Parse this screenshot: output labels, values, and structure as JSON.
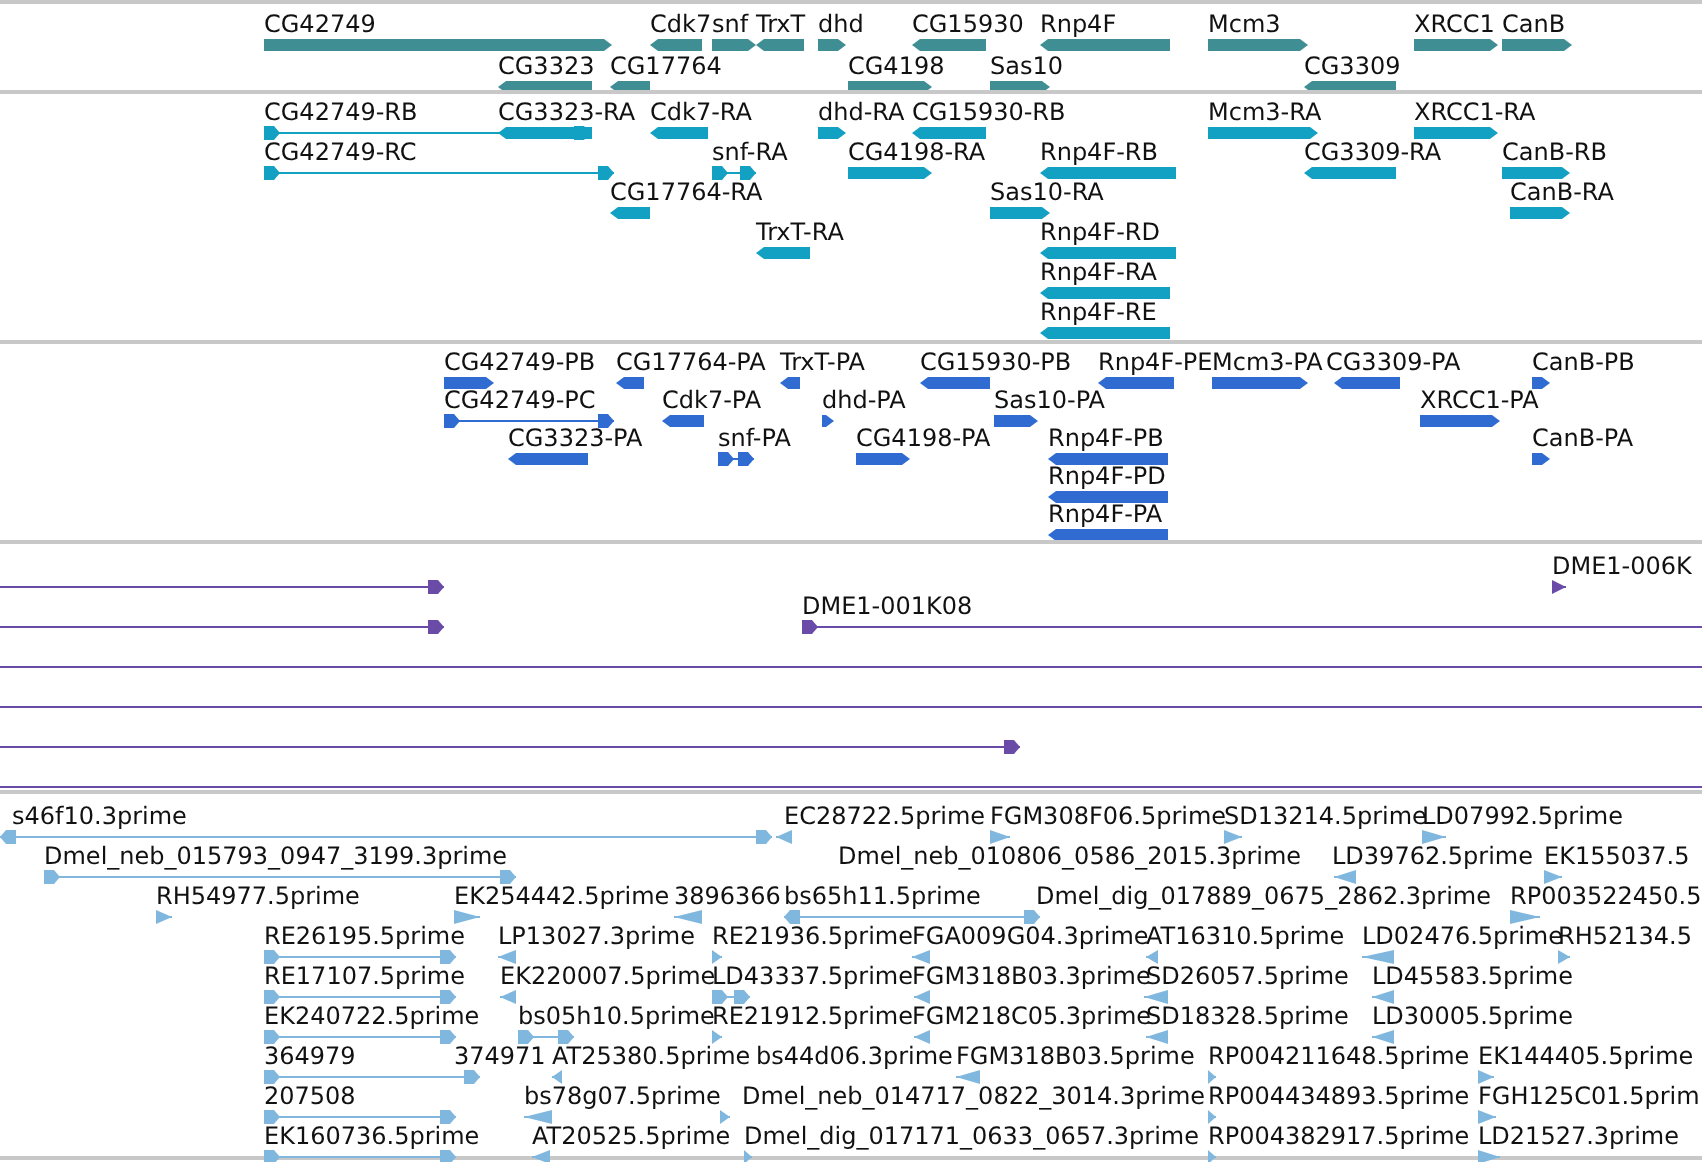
{
  "tracks": [
    {
      "kind": "gene",
      "features": [
        {
          "label": "CG42749",
          "reverse": false
        },
        {
          "label": "Cdk7",
          "reverse": true
        },
        {
          "label": "snf",
          "reverse": false
        },
        {
          "label": "TrxT",
          "reverse": true
        },
        {
          "label": "dhd",
          "reverse": false
        },
        {
          "label": "CG15930",
          "reverse": true
        },
        {
          "label": "Rnp4F",
          "reverse": true
        },
        {
          "label": "Mcm3",
          "reverse": false
        },
        {
          "label": "XRCC1",
          "reverse": false
        },
        {
          "label": "CanB",
          "reverse": false
        },
        {
          "label": "CG3323",
          "reverse": true
        },
        {
          "label": "CG17764",
          "reverse": true
        },
        {
          "label": "CG4198",
          "reverse": false
        },
        {
          "label": "Sas10",
          "reverse": false
        },
        {
          "label": "CG3309",
          "reverse": true
        }
      ]
    },
    {
      "kind": "transcript",
      "features": [
        {
          "label": "CG42749-RB",
          "reverse": false
        },
        {
          "label": "CG3323-RA",
          "reverse": true
        },
        {
          "label": "Cdk7-RA",
          "reverse": true
        },
        {
          "label": "dhd-RA",
          "reverse": false
        },
        {
          "label": "CG15930-RB",
          "reverse": true
        },
        {
          "label": "Mcm3-RA",
          "reverse": false
        },
        {
          "label": "XRCC1-RA",
          "reverse": false
        },
        {
          "label": "CG42749-RC",
          "reverse": false
        },
        {
          "label": "snf-RA",
          "reverse": false
        },
        {
          "label": "CG4198-RA",
          "reverse": false
        },
        {
          "label": "Rnp4F-RB",
          "reverse": true
        },
        {
          "label": "CG3309-RA",
          "reverse": true
        },
        {
          "label": "CanB-RB",
          "reverse": false
        },
        {
          "label": "CG17764-RA",
          "reverse": true
        },
        {
          "label": "Sas10-RA",
          "reverse": false
        },
        {
          "label": "CanB-RA",
          "reverse": false
        },
        {
          "label": "TrxT-RA",
          "reverse": true
        },
        {
          "label": "Rnp4F-RD",
          "reverse": true
        },
        {
          "label": "Rnp4F-RA",
          "reverse": true
        },
        {
          "label": "Rnp4F-RE",
          "reverse": true
        }
      ]
    },
    {
      "kind": "protein",
      "features": [
        {
          "label": "CG42749-PB",
          "reverse": false
        },
        {
          "label": "CG17764-PA",
          "reverse": true
        },
        {
          "label": "TrxT-PA",
          "reverse": true
        },
        {
          "label": "CG15930-PB",
          "reverse": true
        },
        {
          "label": "Rnp4F-PE",
          "reverse": true
        },
        {
          "label": "Mcm3-PA",
          "reverse": false
        },
        {
          "label": "CG3309-PA",
          "reverse": true
        },
        {
          "label": "CanB-PB",
          "reverse": false
        },
        {
          "label": "CG42749-PC",
          "reverse": false
        },
        {
          "label": "Cdk7-PA",
          "reverse": true
        },
        {
          "label": "dhd-PA",
          "reverse": false
        },
        {
          "label": "Sas10-PA",
          "reverse": false
        },
        {
          "label": "XRCC1-PA",
          "reverse": false
        },
        {
          "label": "CG3323-PA",
          "reverse": true
        },
        {
          "label": "snf-PA",
          "reverse": false
        },
        {
          "label": "CG4198-PA",
          "reverse": false
        },
        {
          "label": "Rnp4F-PB",
          "reverse": true
        },
        {
          "label": "CanB-PA",
          "reverse": false
        },
        {
          "label": "Rnp4F-PD",
          "reverse": true
        },
        {
          "label": "Rnp4F-PA",
          "reverse": true
        }
      ]
    },
    {
      "kind": "clone",
      "features": [
        {
          "capped": true
        },
        {
          "label": "DME1-006K",
          "capped": true
        },
        {
          "capped": true
        },
        {
          "label": "DME1-001K08",
          "capped": true
        },
        {
          "capped": false
        },
        {
          "capped": false
        },
        {
          "capped": true
        },
        {
          "capped": false
        }
      ]
    },
    {
      "kind": "est",
      "features": [
        {
          "label": "s46f10.3prime",
          "reverse": true
        },
        {
          "label": "EC28722.5prime",
          "reverse": true
        },
        {
          "label": "FGM308F06.5prime",
          "reverse": false
        },
        {
          "label": "SD13214.5prime",
          "reverse": false
        },
        {
          "label": "LD07992.5prime",
          "reverse": false
        },
        {
          "label": "Dmel_neb_015793_0947_3199.3prime",
          "reverse": false
        },
        {
          "label": "Dmel_neb_010806_0586_2015.3prime"
        },
        {
          "label": "LD39762.5prime",
          "reverse": true
        },
        {
          "label": "EK155037.5",
          "reverse": false
        },
        {
          "label": "RH54977.5prime",
          "reverse": false
        },
        {
          "label": "EK254442.5prime",
          "reverse": false
        },
        {
          "label": "3896366",
          "reverse": true
        },
        {
          "label": "bs65h11.5prime",
          "reverse": true
        },
        {
          "label": "Dmel_dig_017889_0675_2862.3prime"
        },
        {
          "label": "RP003522450.5",
          "reverse": false
        },
        {
          "label": "RE26195.5prime",
          "reverse": false
        },
        {
          "label": "LP13027.3prime",
          "reverse": true
        },
        {
          "label": "RE21936.5prime",
          "reverse": false
        },
        {
          "label": "FGA009G04.3prime",
          "reverse": true
        },
        {
          "label": "AT16310.5prime",
          "reverse": true
        },
        {
          "label": "LD02476.5prime",
          "reverse": true
        },
        {
          "label": "RH52134.5",
          "reverse": false
        },
        {
          "label": "RE17107.5prime",
          "reverse": false
        },
        {
          "label": "EK220007.5prime",
          "reverse": true
        },
        {
          "label": "LD43337.5prime",
          "reverse": false
        },
        {
          "label": "FGM318B03.3prime",
          "reverse": true
        },
        {
          "label": "SD26057.5prime",
          "reverse": true
        },
        {
          "label": "LD45583.5prime",
          "reverse": true
        },
        {
          "label": "EK240722.5prime",
          "reverse": false
        },
        {
          "label": "bs05h10.5prime",
          "reverse": false
        },
        {
          "label": "RE21912.5prime",
          "reverse": false
        },
        {
          "label": "FGM218C05.3prime",
          "reverse": true
        },
        {
          "label": "SD18328.5prime",
          "reverse": true
        },
        {
          "label": "LD30005.5prime",
          "reverse": true
        },
        {
          "label": "364979",
          "reverse": false
        },
        {
          "label": "374971"
        },
        {
          "label": "AT25380.5prime",
          "reverse": true
        },
        {
          "label": "bs44d06.3prime"
        },
        {
          "label": "FGM318B03.5prime",
          "reverse": true
        },
        {
          "label": "RP004211648.5prime",
          "reverse": false
        },
        {
          "label": "EK144405.5prime",
          "reverse": false
        },
        {
          "label": "207508",
          "reverse": false
        },
        {
          "label": "bs78g07.5prime",
          "reverse": true
        },
        {
          "label": "Dmel_neb_014717_0822_3014.3prime",
          "reverse": false
        },
        {
          "label": "RP004434893.5prime",
          "reverse": false
        },
        {
          "label": "FGH125C01.5prim",
          "reverse": false
        },
        {
          "label": "EK160736.5prime",
          "reverse": false
        },
        {
          "label": "AT20525.5prime",
          "reverse": true
        },
        {
          "label": "Dmel_dig_017171_0633_0657.3prime",
          "reverse": false
        },
        {
          "label": "RP004382917.5prime",
          "reverse": false
        },
        {
          "label": "LD21527.3prime",
          "reverse": false
        }
      ]
    }
  ]
}
